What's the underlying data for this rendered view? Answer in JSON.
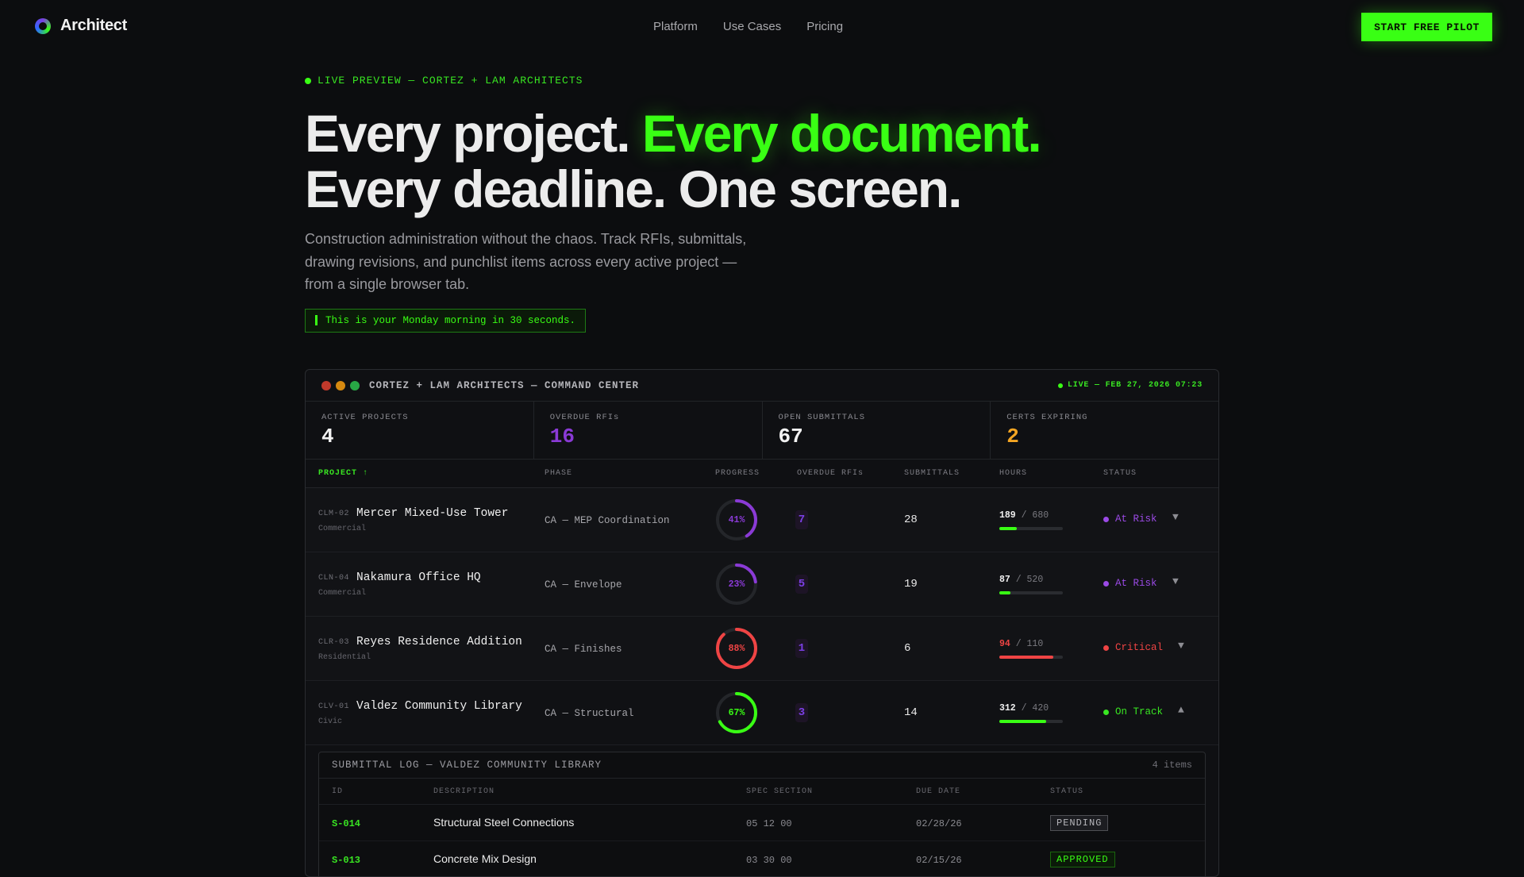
{
  "nav": {
    "brand": "Architect",
    "links": [
      "Platform",
      "Use Cases",
      "Pricing"
    ],
    "cta": "START FREE PILOT"
  },
  "hero": {
    "eyebrow": "LIVE PREVIEW — CORTEZ + LAM ARCHITECTS",
    "headline_part1": "Every project. ",
    "headline_accent": "Every document.",
    "headline_line2": "Every deadline. One screen.",
    "subtext": "Construction administration without the chaos. Track RFIs, submittals, drawing revisions, and punchlist items across every active project — from a single browser tab.",
    "callout": "This is your Monday morning in 30 seconds."
  },
  "panel": {
    "title": "CORTEZ + LAM ARCHITECTS — COMMAND CENTER",
    "live": "LIVE — FEB 27, 2026 07:23",
    "stats": [
      {
        "label": "ACTIVE PROJECTS",
        "value": "4",
        "color": "#f2f2f2"
      },
      {
        "label": "OVERDUE RFIs",
        "value": "16",
        "color": "#8a3ad6"
      },
      {
        "label": "OPEN SUBMITTALS",
        "value": "67",
        "color": "#f2f2f2"
      },
      {
        "label": "CERTS EXPIRING",
        "value": "2",
        "color": "#f5a623"
      }
    ],
    "columns": [
      "PROJECT ↑",
      "PHASE",
      "PROGRESS",
      "OVERDUE RFIs",
      "SUBMITTALS",
      "HOURS",
      "STATUS"
    ],
    "projects": [
      {
        "code": "CLM-02",
        "name": "Mercer Mixed-Use Tower",
        "category": "Commercial",
        "phase": "CA — MEP Coordination",
        "progress": 41,
        "progress_label": "41%",
        "ring_color": "#8a3ad6",
        "rfis": "7",
        "submittals": "28",
        "hours_used": "189",
        "hours_total": "/ 680",
        "hours_fraction": 0.28,
        "hours_color": "#39ff14",
        "hours_used_color": "#f0f0f0",
        "status": "At Risk",
        "status_color": "#9b4ae6",
        "chevron": "▼"
      },
      {
        "code": "CLN-04",
        "name": "Nakamura Office HQ",
        "category": "Commercial",
        "phase": "CA — Envelope",
        "progress": 23,
        "progress_label": "23%",
        "ring_color": "#8a3ad6",
        "rfis": "5",
        "submittals": "19",
        "hours_used": "87",
        "hours_total": "/ 520",
        "hours_fraction": 0.17,
        "hours_color": "#39ff14",
        "hours_used_color": "#f0f0f0",
        "status": "At Risk",
        "status_color": "#9b4ae6",
        "chevron": "▼"
      },
      {
        "code": "CLR-03",
        "name": "Reyes Residence Addition",
        "category": "Residential",
        "phase": "CA — Finishes",
        "progress": 88,
        "progress_label": "88%",
        "ring_color": "#ef4444",
        "rfis": "1",
        "submittals": "6",
        "hours_used": "94",
        "hours_total": "/ 110",
        "hours_fraction": 0.85,
        "hours_color": "#ef4444",
        "hours_used_color": "#ef4444",
        "status": "Critical",
        "status_color": "#ef4444",
        "chevron": "▼"
      },
      {
        "code": "CLV-01",
        "name": "Valdez Community Library",
        "category": "Civic",
        "phase": "CA — Structural",
        "progress": 67,
        "progress_label": "67%",
        "ring_color": "#39ff14",
        "rfis": "3",
        "submittals": "14",
        "hours_used": "312",
        "hours_total": "/ 420",
        "hours_fraction": 0.74,
        "hours_color": "#39ff14",
        "hours_used_color": "#f0f0f0",
        "status": "On Track",
        "status_color": "#39e622",
        "chevron": "▲"
      }
    ],
    "submittal_log": {
      "title": "SUBMITTAL LOG — VALDEZ COMMUNITY LIBRARY",
      "count": "4 items",
      "columns": [
        "ID",
        "DESCRIPTION",
        "SPEC SECTION",
        "DUE DATE",
        "STATUS"
      ],
      "rows": [
        {
          "id": "S-014",
          "description": "Structural Steel Connections",
          "spec": "05 12 00",
          "due": "02/28/26",
          "status": "PENDING",
          "status_color": "#b5b5ba",
          "status_bg": "#1c1d21"
        },
        {
          "id": "S-013",
          "description": "Concrete Mix Design",
          "spec": "03 30 00",
          "due": "02/15/26",
          "status": "APPROVED",
          "status_color": "#39ff14",
          "status_bg": "#0b1a09"
        }
      ]
    }
  }
}
